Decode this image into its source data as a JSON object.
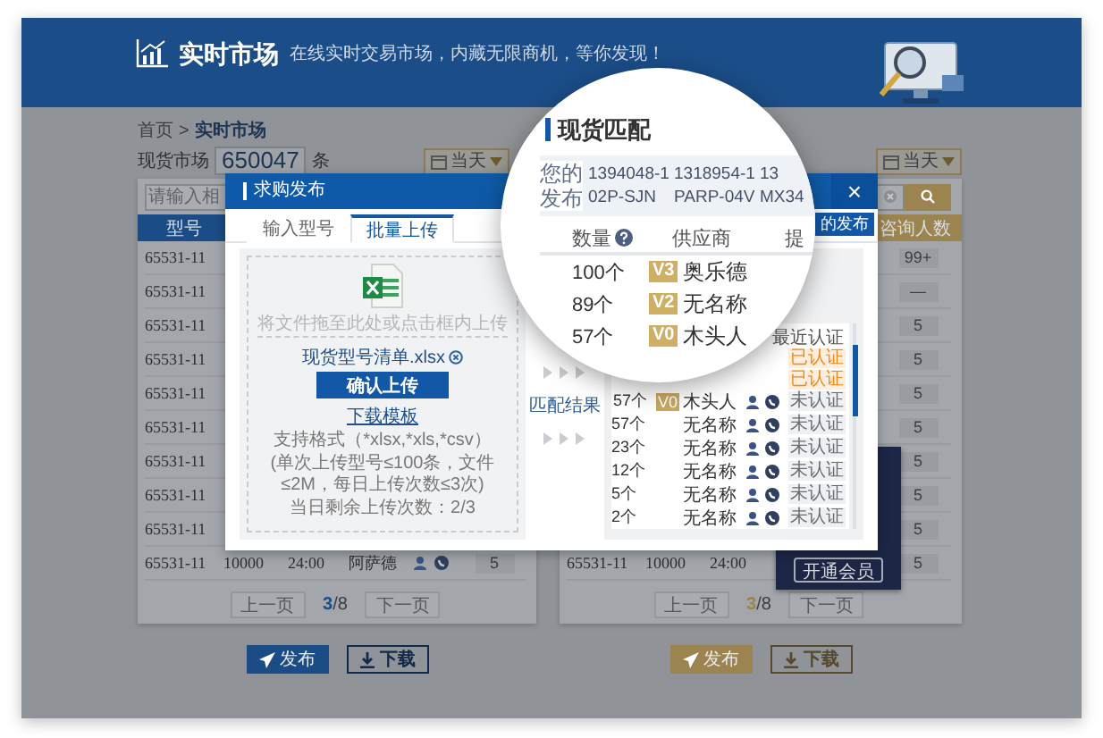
{
  "header": {
    "title": "实时市场",
    "subtitle": "在线实时交易市场，内藏无限商机，等你发现！"
  },
  "breadcrumb": {
    "items": [
      "首页",
      "实时市场"
    ],
    "separator": ">"
  },
  "market": {
    "label": "现货市场",
    "count": "650047",
    "unit": "条"
  },
  "panels": [
    {
      "color": "#1b4c86",
      "date_filter": "当天",
      "search": {
        "placeholder": "请输入相"
      },
      "columns": [
        {
          "kind": "model",
          "label": "型号"
        }
      ],
      "rows": [
        {
          "model": "65531-11"
        },
        {
          "model": "65531-11"
        },
        {
          "model": "65531-11"
        },
        {
          "model": "65531-11"
        },
        {
          "model": "65531-11"
        },
        {
          "model": "65531-11"
        },
        {
          "model": "65531-11"
        },
        {
          "model": "65531-11"
        },
        {
          "model": "65531-11"
        },
        {
          "model": "65531-11",
          "quantity": "10000",
          "time": "24:00",
          "supplier": "阿萨德",
          "contact_icons": true,
          "count": "5"
        }
      ],
      "pagination": {
        "prev": "上一页",
        "current": "3",
        "total": "/8",
        "next": "下一页"
      },
      "buttons": [
        {
          "label": "发布",
          "kind": "publish"
        },
        {
          "label": "下载",
          "kind": "download"
        }
      ]
    },
    {
      "color": "#9c8450",
      "date_filter": "当天",
      "search": {
        "clear": true
      },
      "columns": [
        {
          "kind": "count",
          "label": "咨询人数"
        }
      ],
      "rows": [
        {
          "count": "99+"
        },
        {
          "count": "—"
        },
        {
          "count": "5"
        },
        {
          "count": "5"
        },
        {
          "count": "5"
        },
        {
          "count": "5"
        },
        {
          "count": "5"
        },
        {
          "count": "5"
        },
        {
          "count": "5"
        },
        {
          "model": "65531-11",
          "quantity": "10000",
          "time": "24:00",
          "count": "5"
        }
      ],
      "promo": {
        "button": "开通会员"
      },
      "pagination": {
        "prev": "上一页",
        "current": "3",
        "total": "/8",
        "next": "下一页"
      },
      "buttons": [
        {
          "label": "发布",
          "kind": "publish"
        },
        {
          "label": "下载",
          "kind": "download"
        }
      ]
    }
  ],
  "modal": {
    "title": "求购发布",
    "close": "×",
    "tabs": [
      {
        "label": "输入型号",
        "selected": false
      },
      {
        "label": "批量上传",
        "selected": true
      }
    ],
    "publish_button": "的发布",
    "upload": {
      "hint": "将文件拖至此处或点击框内上传",
      "file": "现货型号清单.xlsx",
      "confirm": "确认上传",
      "template_link": "下载模板",
      "formats": "支持格式（*xlsx,*xls,*csv）",
      "limits": "(单次上传型号≤100条，文件≤2M，每日上传次数≤3次)",
      "remaining": "当日剩余上传次数：2/3"
    },
    "match_label": "匹配结果",
    "results": {
      "header": "最近认证",
      "rows": [
        {
          "tag": "已认证",
          "verified": true
        },
        {
          "tag": "已认证",
          "verified": true
        },
        {
          "quantity": "57个",
          "grade": "V0",
          "supplier": "木头人",
          "tag": "未认证",
          "verified": false
        },
        {
          "quantity": "57个",
          "supplier": "无名称",
          "tag": "未认证",
          "verified": false
        },
        {
          "quantity": "23个",
          "supplier": "无名称",
          "tag": "未认证",
          "verified": false
        },
        {
          "quantity": "12个",
          "supplier": "无名称",
          "tag": "未认证",
          "verified": false
        },
        {
          "quantity": "5个",
          "supplier": "无名称",
          "tag": "未认证",
          "verified": false
        },
        {
          "quantity": "2个",
          "supplier": "无名称",
          "tag": "未认证",
          "verified": false
        }
      ]
    }
  },
  "magnifier": {
    "title": "现货匹配",
    "label": "您的发布",
    "codes": [
      "1394048-1",
      "1318954-1",
      "13",
      "02P-SJN",
      "PARP-04V",
      "MX34"
    ],
    "columns": [
      "数量",
      "供应商",
      "提"
    ],
    "rows": [
      {
        "quantity": "100个",
        "grade": "V3",
        "supplier": "奥乐德"
      },
      {
        "quantity": "89个",
        "grade": "V2",
        "supplier": "无名称"
      },
      {
        "quantity": "57个",
        "grade": "V0",
        "supplier": "木头人"
      }
    ]
  }
}
